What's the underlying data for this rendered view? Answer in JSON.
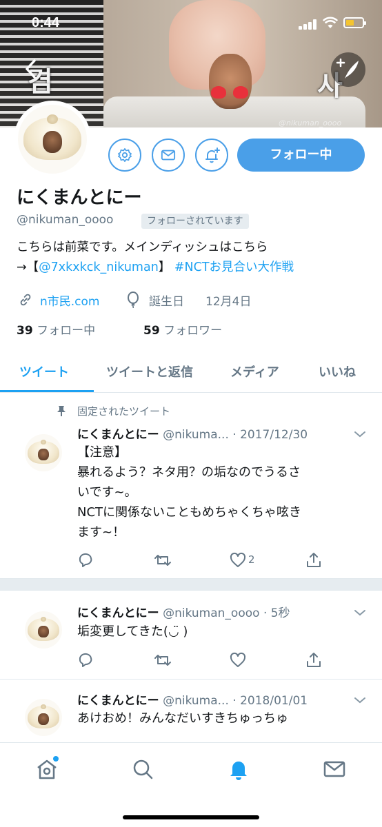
{
  "status_bar": {
    "time": "0:44"
  },
  "banner": {
    "left_char": "겸",
    "right_char": "사",
    "watermark": "@nikuman_oooo"
  },
  "profile": {
    "display_name": "にくまんとにー",
    "handle": "@nikuman_oooo",
    "follows_you": "フォローされています",
    "follow_button": "フォロー中",
    "bio_line1": "こちらは前菜です。メインディッシュはこちら",
    "bio_arrow": "→【",
    "bio_link": "@7xkxkck_nikuman",
    "bio_close": "】 ",
    "bio_hashtag": "#NCTお見合い大作戦",
    "website": "n市民.com",
    "birthday_label": "誕生日",
    "birthday_value": "12月4日",
    "following_count": "39",
    "following_label": "フォロー中",
    "followers_count": "59",
    "followers_label": "フォロワー"
  },
  "tabs": [
    {
      "label": "ツイート",
      "active": true
    },
    {
      "label": "ツイートと返信",
      "active": false
    },
    {
      "label": "メディア",
      "active": false
    },
    {
      "label": "いいね",
      "active": false
    }
  ],
  "pinned_label": "固定されたツイート",
  "tweets": [
    {
      "name": "にくまんとにー",
      "handle": "@nikuma...",
      "time": "· 2017/12/30",
      "lines": [
        "【注意】",
        "暴れるよう？ネタ用？の垢なのでうるさ",
        "いです~。",
        "NCTに関係ないこともめちゃくちゃ呟き",
        "ます~！"
      ],
      "likes": "2"
    },
    {
      "name": "にくまんとにー",
      "handle": "@nikuman_oooo",
      "time": "· 5秒",
      "lines": [
        "垢変更してきた(◡̈ )"
      ],
      "likes": ""
    },
    {
      "name": "にくまんとにー",
      "handle": "@nikuma...",
      "time": "· 2018/01/01",
      "lines": [
        "あけおめ！みんなだいすきちゅっちゅ"
      ],
      "likes": ""
    }
  ],
  "colors": {
    "accent": "#1da1f2",
    "button": "#4a9fe8",
    "text": "#14171a",
    "muted": "#657786"
  },
  "icons": {
    "back": "chevron-left-icon",
    "compose": "compose-icon",
    "settings": "gear-icon",
    "message": "envelope-icon",
    "notify": "bell-plus-icon",
    "link": "link-icon",
    "birthday": "balloon-icon",
    "pin": "pin-icon",
    "reply": "reply-icon",
    "retweet": "retweet-icon",
    "like": "heart-icon",
    "share": "share-icon",
    "home": "home-icon",
    "search": "search-icon",
    "notifications": "bell-icon",
    "messages": "envelope-icon"
  }
}
